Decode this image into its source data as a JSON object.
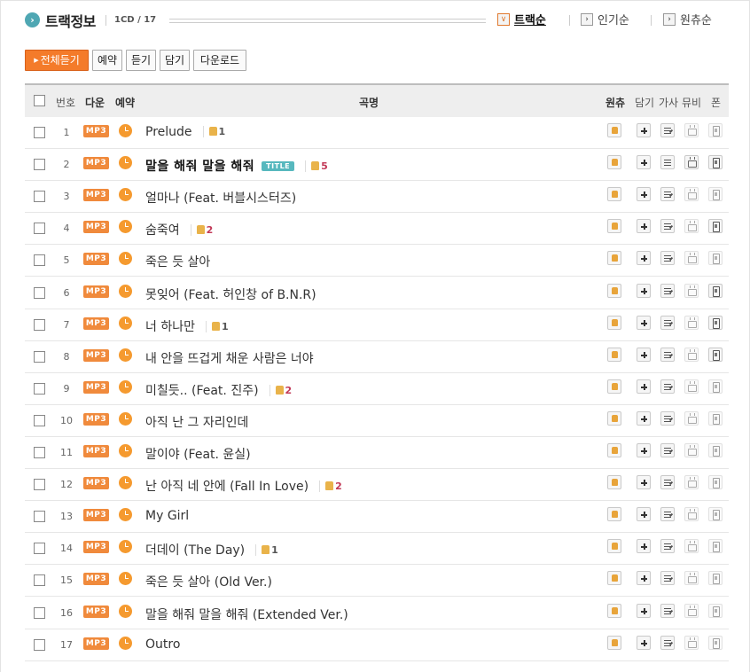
{
  "header": {
    "icon": "chevron-right-circle-icon",
    "title": "트랙정보",
    "count": "1CD / 17",
    "sort_options": [
      {
        "label": "트랙순",
        "active": true,
        "mark": "∨"
      },
      {
        "label": "인기순",
        "active": false,
        "mark": "›"
      },
      {
        "label": "원츄순",
        "active": false,
        "mark": "›"
      }
    ]
  },
  "actions": {
    "play_all": "전체듣기",
    "reserve": "예약",
    "listen": "듣기",
    "add": "담기",
    "download": "다운로드"
  },
  "columns": {
    "number": "번호",
    "download": "다운",
    "reserve": "예약",
    "title": "곡명",
    "like": "원츄",
    "add": "담기",
    "lyrics": "가사",
    "mv": "뮤비",
    "phone": "폰"
  },
  "tracks": [
    {
      "no": "1",
      "title": "Prelude",
      "likes": "1",
      "hot": false,
      "title_track": false,
      "mv": false,
      "phone": false
    },
    {
      "no": "2",
      "title": "말을 해줘 말을 해줘",
      "likes": "5",
      "hot": true,
      "title_track": true,
      "mv": true,
      "phone": true
    },
    {
      "no": "3",
      "title": "얼마나 (Feat. 버블시스터즈)",
      "likes": "",
      "hot": false,
      "title_track": false,
      "mv": false,
      "phone": false
    },
    {
      "no": "4",
      "title": "숨죽여",
      "likes": "2",
      "hot": true,
      "title_track": false,
      "mv": false,
      "phone": true
    },
    {
      "no": "5",
      "title": "죽은 듯 살아",
      "likes": "",
      "hot": false,
      "title_track": false,
      "mv": false,
      "phone": false
    },
    {
      "no": "6",
      "title": "못잊어 (Feat. 허인창 of B.N.R)",
      "likes": "",
      "hot": false,
      "title_track": false,
      "mv": false,
      "phone": true
    },
    {
      "no": "7",
      "title": "너 하나만",
      "likes": "1",
      "hot": false,
      "title_track": false,
      "mv": false,
      "phone": true
    },
    {
      "no": "8",
      "title": "내 안을 뜨겁게 채운 사람은 너야",
      "likes": "",
      "hot": false,
      "title_track": false,
      "mv": false,
      "phone": true
    },
    {
      "no": "9",
      "title": "미칠듯.. (Feat. 진주)",
      "likes": "2",
      "hot": true,
      "title_track": false,
      "mv": false,
      "phone": false
    },
    {
      "no": "10",
      "title": "아직 난 그 자리인데",
      "likes": "",
      "hot": false,
      "title_track": false,
      "mv": false,
      "phone": false
    },
    {
      "no": "11",
      "title": "말이야 (Feat. 윤실)",
      "likes": "",
      "hot": false,
      "title_track": false,
      "mv": false,
      "phone": false
    },
    {
      "no": "12",
      "title": "난 아직 네 안에 (Fall In Love)",
      "likes": "2",
      "hot": true,
      "title_track": false,
      "mv": false,
      "phone": false
    },
    {
      "no": "13",
      "title": "My Girl",
      "likes": "",
      "hot": false,
      "title_track": false,
      "mv": false,
      "phone": false
    },
    {
      "no": "14",
      "title": "더데이 (The Day)",
      "likes": "1",
      "hot": false,
      "title_track": false,
      "mv": false,
      "phone": false
    },
    {
      "no": "15",
      "title": "죽은 듯 살아 (Old Ver.)",
      "likes": "",
      "hot": false,
      "title_track": false,
      "mv": false,
      "phone": false
    },
    {
      "no": "16",
      "title": "말을 해줘 말을 해줘 (Extended Ver.)",
      "likes": "",
      "hot": false,
      "title_track": false,
      "mv": false,
      "phone": false
    },
    {
      "no": "17",
      "title": "Outro",
      "likes": "",
      "hot": false,
      "title_track": false,
      "mv": false,
      "phone": false
    }
  ],
  "labels": {
    "mp3": "MP3",
    "title_badge": "TITLE"
  },
  "colors": {
    "accent": "#f47b2a",
    "teal": "#4fa7b3",
    "hot_count": "#c23a58",
    "header_bg": "#eeeeee"
  }
}
